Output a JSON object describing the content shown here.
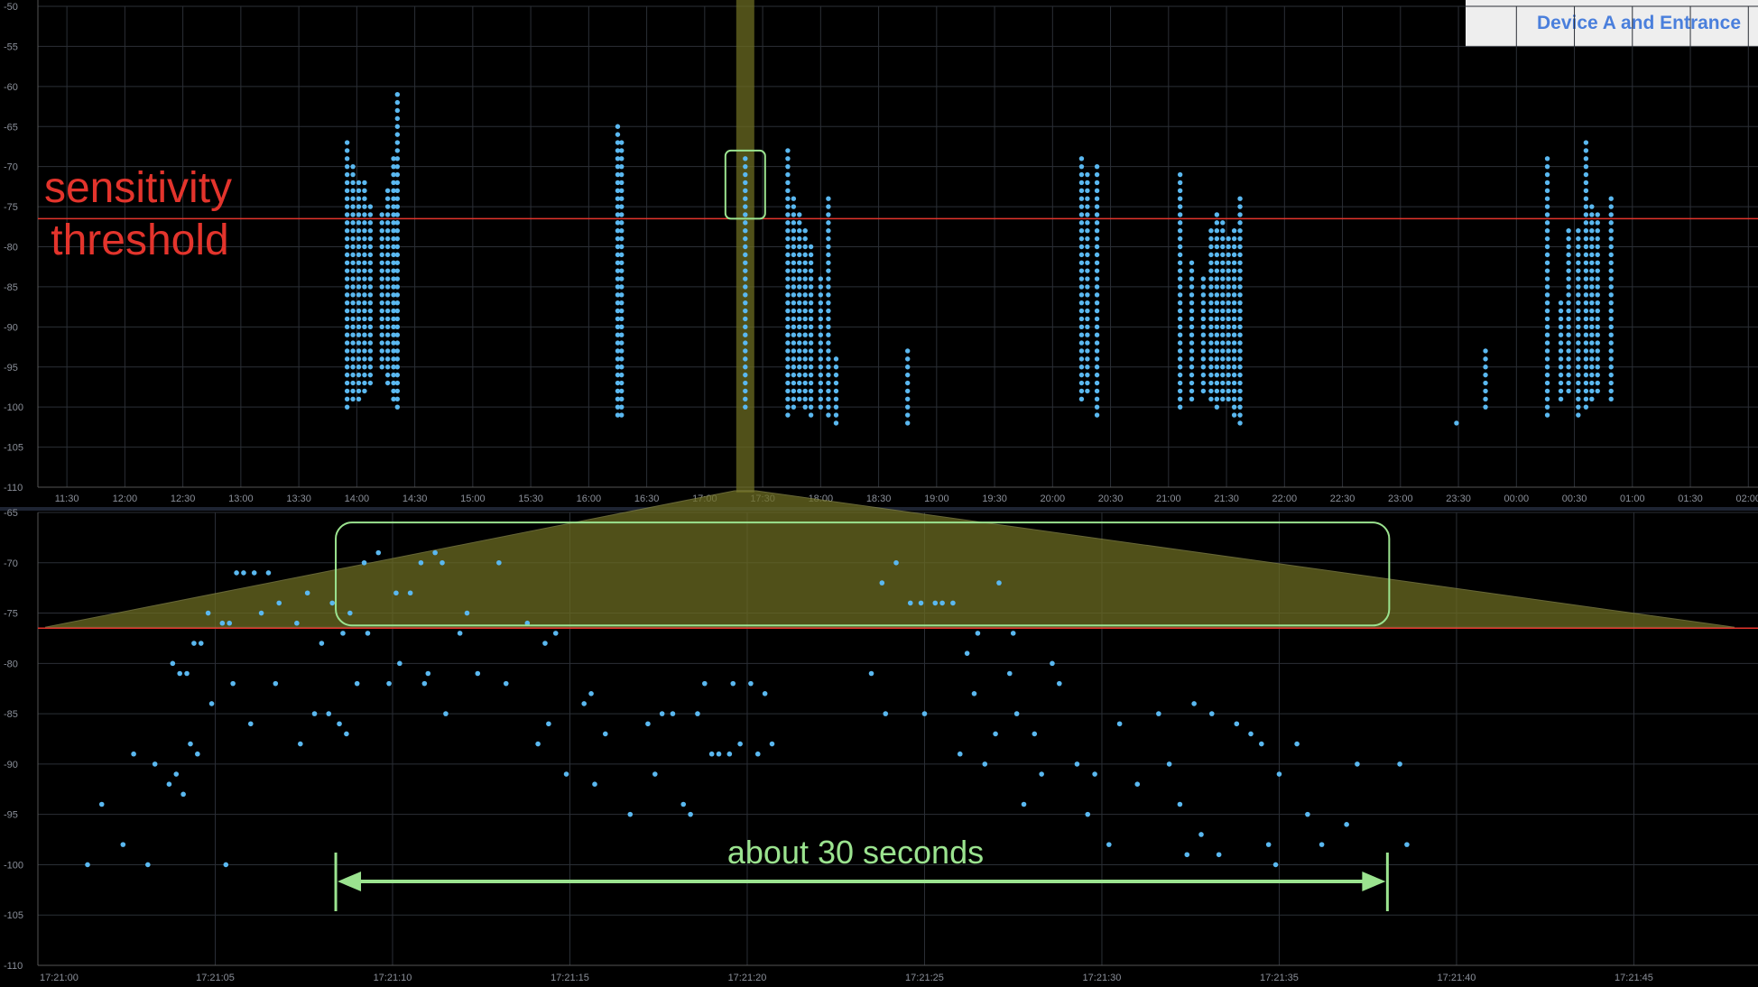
{
  "legend": {
    "label": "Device A and Entrance"
  },
  "annotations": {
    "threshold_line1": "sensitivity",
    "threshold_line2": "threshold",
    "duration": "about 30 seconds"
  },
  "colors": {
    "background": "#000000",
    "grid": "#2b2f36",
    "points": "#5ab8f0",
    "threshold": "#e3342c",
    "highlight": "#9be38f",
    "zoom_fill": "#6b6b22",
    "legend_text": "#4a7fdc"
  },
  "chart_data": [
    {
      "type": "scatter",
      "title": "",
      "ylim": [
        -110,
        -50
      ],
      "xlim": [
        "11:15",
        "02:05"
      ],
      "grid": true,
      "threshold": -76.5,
      "yticks": [
        "-50",
        "-55",
        "-60",
        "-65",
        "-70",
        "-75",
        "-80",
        "-85",
        "-90",
        "-95",
        "-100",
        "-105",
        "-110"
      ],
      "xticks": [
        "11:30",
        "12:00",
        "12:30",
        "13:00",
        "13:30",
        "14:00",
        "14:30",
        "15:00",
        "15:30",
        "16:00",
        "16:30",
        "17:00",
        "17:30",
        "18:00",
        "18:30",
        "19:00",
        "19:30",
        "20:00",
        "20:30",
        "21:00",
        "21:30",
        "22:00",
        "22:30",
        "23:00",
        "23:30",
        "00:00",
        "00:30",
        "01:00",
        "01:30",
        "02:00"
      ],
      "clusters": [
        {
          "time": "13:55",
          "ymin": -100,
          "ymax": -67
        },
        {
          "time": "13:58",
          "ymin": -99,
          "ymax": -70
        },
        {
          "time": "14:01",
          "ymin": -99,
          "ymax": -72
        },
        {
          "time": "14:04",
          "ymin": -98,
          "ymax": -72
        },
        {
          "time": "14:07",
          "ymin": -97,
          "ymax": -75
        },
        {
          "time": "14:13",
          "ymin": -95,
          "ymax": -76
        },
        {
          "time": "14:16",
          "ymin": -97,
          "ymax": -73
        },
        {
          "time": "14:19",
          "ymin": -99,
          "ymax": -69
        },
        {
          "time": "14:21",
          "ymin": -100,
          "ymax": -61
        },
        {
          "time": "16:15",
          "ymin": -101,
          "ymax": -65
        },
        {
          "time": "16:17",
          "ymin": -101,
          "ymax": -67
        },
        {
          "time": "17:21",
          "ymin": -100,
          "ymax": -69
        },
        {
          "time": "17:43",
          "ymin": -101,
          "ymax": -68
        },
        {
          "time": "17:46",
          "ymin": -100,
          "ymax": -74
        },
        {
          "time": "17:49",
          "ymin": -99,
          "ymax": -76
        },
        {
          "time": "17:52",
          "ymin": -100,
          "ymax": -78
        },
        {
          "time": "17:55",
          "ymin": -101,
          "ymax": -80
        },
        {
          "time": "18:00",
          "ymin": -100,
          "ymax": -84
        },
        {
          "time": "18:04",
          "ymin": -101,
          "ymax": -74
        },
        {
          "time": "18:08",
          "ymin": -102,
          "ymax": -94
        },
        {
          "time": "18:45",
          "ymin": -102,
          "ymax": -93
        },
        {
          "time": "20:15",
          "ymin": -99,
          "ymax": -69
        },
        {
          "time": "20:18",
          "ymin": -98,
          "ymax": -71
        },
        {
          "time": "20:23",
          "ymin": -101,
          "ymax": -70
        },
        {
          "time": "21:06",
          "ymin": -100,
          "ymax": -71
        },
        {
          "time": "21:12",
          "ymin": -99,
          "ymax": -82
        },
        {
          "time": "21:18",
          "ymin": -98,
          "ymax": -84
        },
        {
          "time": "21:22",
          "ymin": -99,
          "ymax": -78
        },
        {
          "time": "21:25",
          "ymin": -100,
          "ymax": -76
        },
        {
          "time": "21:28",
          "ymin": -99,
          "ymax": -77
        },
        {
          "time": "21:31",
          "ymin": -99,
          "ymax": -79
        },
        {
          "time": "21:34",
          "ymin": -101,
          "ymax": -78
        },
        {
          "time": "21:37",
          "ymin": -102,
          "ymax": -74
        },
        {
          "time": "23:29",
          "ymin": -102,
          "ymax": -102
        },
        {
          "time": "23:44",
          "ymin": -100,
          "ymax": -93
        },
        {
          "time": "00:16",
          "ymin": -101,
          "ymax": -69
        },
        {
          "time": "00:23",
          "ymin": -99,
          "ymax": -87
        },
        {
          "time": "00:27",
          "ymin": -98,
          "ymax": -78
        },
        {
          "time": "00:32",
          "ymin": -101,
          "ymax": -78
        },
        {
          "time": "00:36",
          "ymin": -100,
          "ymax": -67
        },
        {
          "time": "00:39",
          "ymin": -99,
          "ymax": -75
        },
        {
          "time": "00:42",
          "ymin": -98,
          "ymax": -76
        },
        {
          "time": "00:49",
          "ymin": -99,
          "ymax": -74
        }
      ]
    },
    {
      "type": "scatter",
      "title": "",
      "ylim": [
        -110,
        -65
      ],
      "xlim": [
        "17:21:00",
        "17:21:48.5"
      ],
      "grid": true,
      "threshold": -76.5,
      "yticks": [
        "-65",
        "-70",
        "-75",
        "-80",
        "-85",
        "-90",
        "-95",
        "-100",
        "-105",
        "-110"
      ],
      "xticks": [
        "17:21:00",
        "17:21:05",
        "17:21:10",
        "17:21:15",
        "17:21:20",
        "17:21:25",
        "17:21:30",
        "17:21:35",
        "17:21:40",
        "17:21:45"
      ],
      "above_threshold_window": [
        "17:21:08.5",
        "17:21:38"
      ],
      "points": [
        [
          1.4,
          -100
        ],
        [
          1.8,
          -94
        ],
        [
          2.4,
          -98
        ],
        [
          2.7,
          -89
        ],
        [
          3.1,
          -100
        ],
        [
          3.3,
          -90
        ],
        [
          3.7,
          -92
        ],
        [
          3.8,
          -80
        ],
        [
          3.9,
          -91
        ],
        [
          4.0,
          -81
        ],
        [
          4.1,
          -93
        ],
        [
          4.2,
          -81
        ],
        [
          4.3,
          -88
        ],
        [
          4.4,
          -78
        ],
        [
          4.5,
          -89
        ],
        [
          4.6,
          -78
        ],
        [
          4.8,
          -75
        ],
        [
          4.9,
          -84
        ],
        [
          5.2,
          -76
        ],
        [
          5.3,
          -100
        ],
        [
          5.4,
          -76
        ],
        [
          5.5,
          -82
        ],
        [
          5.6,
          -71
        ],
        [
          5.8,
          -71
        ],
        [
          6.0,
          -86
        ],
        [
          6.1,
          -71
        ],
        [
          6.3,
          -75
        ],
        [
          6.5,
          -71
        ],
        [
          6.7,
          -82
        ],
        [
          6.8,
          -74
        ],
        [
          7.3,
          -76
        ],
        [
          7.4,
          -88
        ],
        [
          7.6,
          -73
        ],
        [
          7.8,
          -85
        ],
        [
          8.0,
          -78
        ],
        [
          8.2,
          -85
        ],
        [
          8.3,
          -74
        ],
        [
          8.5,
          -86
        ],
        [
          8.6,
          -77
        ],
        [
          8.7,
          -87
        ],
        [
          8.8,
          -75
        ],
        [
          9.0,
          -82
        ],
        [
          9.2,
          -70
        ],
        [
          9.3,
          -77
        ],
        [
          9.6,
          -69
        ],
        [
          9.9,
          -82
        ],
        [
          10.1,
          -73
        ],
        [
          10.2,
          -80
        ],
        [
          10.5,
          -73
        ],
        [
          10.8,
          -70
        ],
        [
          10.9,
          -82
        ],
        [
          11.0,
          -81
        ],
        [
          11.2,
          -69
        ],
        [
          11.4,
          -70
        ],
        [
          11.5,
          -85
        ],
        [
          11.9,
          -77
        ],
        [
          12.1,
          -75
        ],
        [
          12.4,
          -81
        ],
        [
          13.0,
          -70
        ],
        [
          13.2,
          -82
        ],
        [
          13.8,
          -76
        ],
        [
          14.1,
          -88
        ],
        [
          14.3,
          -78
        ],
        [
          14.4,
          -86
        ],
        [
          14.6,
          -77
        ],
        [
          14.9,
          -91
        ],
        [
          15.4,
          -84
        ],
        [
          15.6,
          -83
        ],
        [
          15.7,
          -92
        ],
        [
          16.0,
          -87
        ],
        [
          16.7,
          -95
        ],
        [
          17.2,
          -86
        ],
        [
          17.4,
          -91
        ],
        [
          17.6,
          -85
        ],
        [
          17.9,
          -85
        ],
        [
          18.2,
          -94
        ],
        [
          18.4,
          -95
        ],
        [
          18.6,
          -85
        ],
        [
          18.8,
          -82
        ],
        [
          19.0,
          -89
        ],
        [
          19.2,
          -89
        ],
        [
          19.5,
          -89
        ],
        [
          19.6,
          -82
        ],
        [
          19.8,
          -88
        ],
        [
          20.1,
          -82
        ],
        [
          20.3,
          -89
        ],
        [
          20.5,
          -83
        ],
        [
          20.7,
          -88
        ],
        [
          23.5,
          -81
        ],
        [
          23.8,
          -72
        ],
        [
          23.9,
          -85
        ],
        [
          24.2,
          -70
        ],
        [
          24.6,
          -74
        ],
        [
          24.9,
          -74
        ],
        [
          25.0,
          -85
        ],
        [
          25.3,
          -74
        ],
        [
          25.5,
          -74
        ],
        [
          25.8,
          -74
        ],
        [
          26.0,
          -89
        ],
        [
          26.2,
          -79
        ],
        [
          26.4,
          -83
        ],
        [
          26.5,
          -77
        ],
        [
          26.7,
          -90
        ],
        [
          27.0,
          -87
        ],
        [
          27.1,
          -72
        ],
        [
          27.4,
          -81
        ],
        [
          27.5,
          -77
        ],
        [
          27.6,
          -85
        ],
        [
          27.8,
          -94
        ],
        [
          28.1,
          -87
        ],
        [
          28.3,
          -91
        ],
        [
          28.6,
          -80
        ],
        [
          28.8,
          -82
        ],
        [
          29.3,
          -90
        ],
        [
          29.6,
          -95
        ],
        [
          29.8,
          -91
        ],
        [
          30.2,
          -98
        ],
        [
          30.5,
          -86
        ],
        [
          31.0,
          -92
        ],
        [
          31.6,
          -85
        ],
        [
          31.9,
          -90
        ],
        [
          32.2,
          -94
        ],
        [
          32.4,
          -99
        ],
        [
          32.6,
          -84
        ],
        [
          32.8,
          -97
        ],
        [
          33.1,
          -85
        ],
        [
          33.3,
          -99
        ],
        [
          33.8,
          -86
        ],
        [
          34.2,
          -87
        ],
        [
          34.5,
          -88
        ],
        [
          34.7,
          -98
        ],
        [
          34.9,
          -100
        ],
        [
          35.0,
          -91
        ],
        [
          35.5,
          -88
        ],
        [
          35.8,
          -95
        ],
        [
          36.2,
          -98
        ],
        [
          36.9,
          -96
        ],
        [
          37.2,
          -90
        ],
        [
          38.4,
          -90
        ],
        [
          38.6,
          -98
        ]
      ]
    }
  ]
}
